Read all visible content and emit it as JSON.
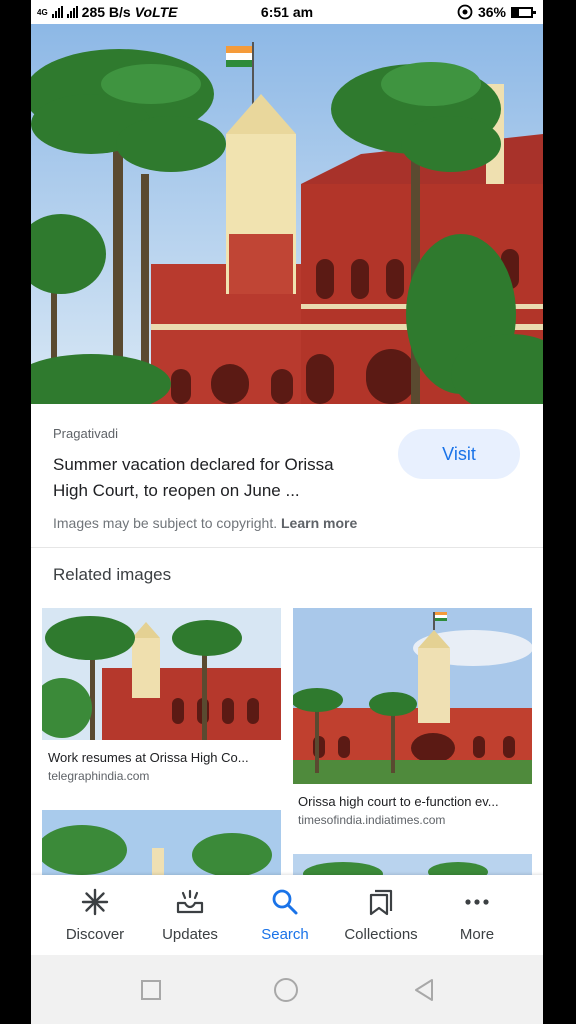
{
  "status_bar": {
    "network_type": "4G",
    "speed": "285 B/s",
    "volte": "VoLTE",
    "time": "6:51 am",
    "battery_percent": "36%",
    "battery_level": 0.36
  },
  "result": {
    "source": "Pragativadi",
    "title_line1": "Summer vacation declared for Orissa",
    "title_line2": "High Court, to reopen on June ...",
    "visit_label": "Visit",
    "copyright_text": "Images may be subject to copyright.",
    "learn_more": "Learn more"
  },
  "related": {
    "heading": "Related images",
    "items": [
      {
        "caption": "Work resumes at Orissa High Co...",
        "domain": "telegraphindia.com"
      },
      {
        "caption": "Orissa high court to e-function ev...",
        "domain": "timesofindia.indiatimes.com"
      }
    ]
  },
  "bottom_nav": {
    "items": [
      {
        "label": "Discover",
        "icon": "asterisk-icon"
      },
      {
        "label": "Updates",
        "icon": "inbox-notification-icon"
      },
      {
        "label": "Search",
        "icon": "search-icon",
        "active": true
      },
      {
        "label": "Collections",
        "icon": "collections-icon"
      },
      {
        "label": "More",
        "icon": "more-dots-icon"
      }
    ]
  },
  "colors": {
    "accent": "#1a73e8",
    "visit_bg": "#e8f0fe",
    "building_red": "#b83a2e"
  }
}
